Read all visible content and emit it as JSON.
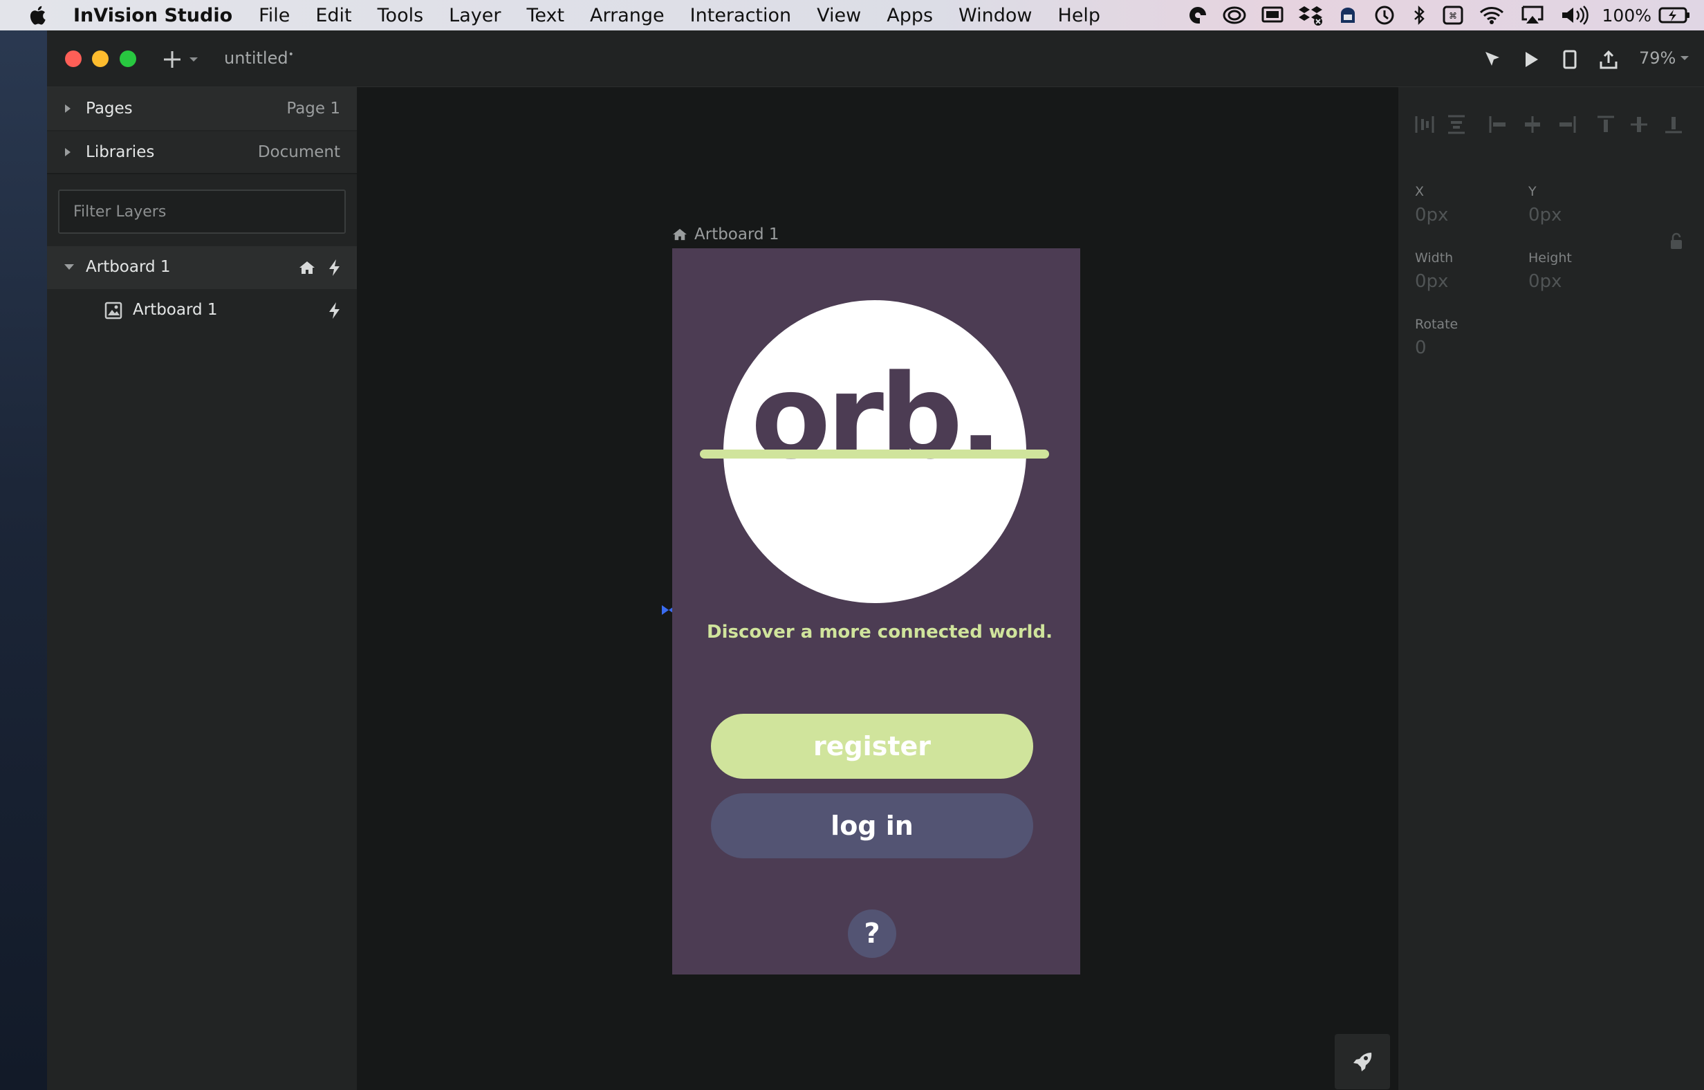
{
  "menubar": {
    "app_name": "InVision Studio",
    "items": [
      "File",
      "Edit",
      "Tools",
      "Layer",
      "Text",
      "Arrange",
      "Interaction",
      "View",
      "Apps",
      "Window",
      "Help"
    ],
    "status_icons": [
      "creative-cloud-icon",
      "cc-libraries-icon",
      "screen-mirror-icon",
      "dropbox-icon",
      "backup-icon",
      "time-machine-icon",
      "bluetooth-icon",
      "keyboard-icon",
      "wifi-icon",
      "airplay-icon",
      "volume-icon"
    ],
    "battery_percent": "100%"
  },
  "window": {
    "document_title": "untitled",
    "modified_marker": "•",
    "zoom": "79%",
    "toolbar_icons": [
      "preview-cursor-icon",
      "play-icon",
      "device-icon",
      "share-icon"
    ]
  },
  "sidebar": {
    "pages_label": "Pages",
    "pages_value": "Page 1",
    "libraries_label": "Libraries",
    "libraries_value": "Document",
    "filter_placeholder": "Filter Layers",
    "layers": [
      {
        "name": "Artboard 1",
        "expanded": true,
        "icons": [
          "home-icon",
          "bolt-icon"
        ]
      },
      {
        "name": "Artboard 1",
        "type": "image",
        "icons": [
          "bolt-icon"
        ]
      }
    ]
  },
  "canvas": {
    "artboard_label": "Artboard 1",
    "app_screen": {
      "logo_text": "orb.",
      "tagline": "Discover a more connected world.",
      "register_label": "register",
      "login_label": "log in",
      "help_label": "?",
      "colors": {
        "background": "#4c3c53",
        "accent": "#d0e49c",
        "secondary": "#535473",
        "circle": "#ffffff"
      }
    }
  },
  "inspector": {
    "x_label": "X",
    "x_value": "0px",
    "y_label": "Y",
    "y_value": "0px",
    "width_label": "Width",
    "width_value": "0px",
    "height_label": "Height",
    "height_value": "0px",
    "rotate_label": "Rotate",
    "rotate_value": "0"
  }
}
